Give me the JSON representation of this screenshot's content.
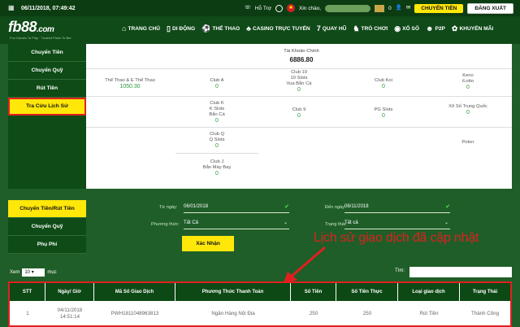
{
  "topbar": {
    "datetime": "06/11/2018, 07:49:42",
    "support_label": "Hỗ Trợ",
    "greeting": "Xin chào,",
    "balance_short": "0",
    "transfer_button": "CHUYỂN TIỀN",
    "logout_button": "ĐĂNG XUẤT"
  },
  "logo": {
    "main": "fb88",
    "suffix": ".com",
    "tagline": "Fun Games To Play · Trusted Place To Bet"
  },
  "nav": [
    "TRANG CHỦ",
    "DI ĐỘNG",
    "THỂ THAO",
    "CASINO TRỰC TUYẾN",
    "QUAY HŨ",
    "TRÒ CHƠI",
    "XỔ SỐ",
    "P2P",
    "KHUYẾN MÃI"
  ],
  "sidebar_top": [
    "Chuyển Tiền",
    "Chuyển Quỹ",
    "Rút Tiền",
    "Tra Cứu Lịch Sử"
  ],
  "main_account": {
    "label": "Tài Khoản Chính",
    "value": "6886.80"
  },
  "wallets": [
    {
      "name": "Thể Thao & E Thể Thao",
      "value": "1050.30"
    },
    {
      "name": "Club A",
      "value": "0"
    },
    {
      "name": "Club 10\n10 Slots\nVua Bắn Cá",
      "value": "0"
    },
    {
      "name": "Club Koi",
      "value": "0"
    },
    {
      "name": "Keno\niLotto",
      "value": "0"
    },
    {
      "name": "Club K\nK Slots\nBắn Cá",
      "value": "0"
    },
    {
      "name": "Club 9",
      "value": "0"
    },
    {
      "name": "PG Slots",
      "value": "0"
    },
    {
      "name": "Xổ Số Trung Quốc",
      "value": "0"
    },
    {
      "name": "Club Q\nQ Slots",
      "value": "0"
    },
    {
      "name": "Poker",
      "value": ""
    },
    {
      "name": "Club J\nBắn Máy Bay",
      "value": "0"
    }
  ],
  "sidebar_bottom": [
    "Chuyển Tiền/Rút Tiền",
    "Chuyển Quỹ",
    "Phụ Phí"
  ],
  "filters": {
    "from_label": "Từ ngày:",
    "from_value": "06/01/2018",
    "to_label": "Đến ngày:",
    "to_value": "06/11/2018",
    "method_label": "Phương thức:",
    "method_value": "Tất Cả",
    "status_label": "Trạng thái:",
    "status_value": "Tất cả",
    "confirm_button": "Xác Nhận"
  },
  "annotation": "Lịch sử giao dịch đã cập nhật",
  "paging": {
    "show_label": "Xem",
    "show_value": "10",
    "unit": "mục",
    "search_label": "Tìm:"
  },
  "table": {
    "headers": [
      "STT",
      "Ngày/ Giờ",
      "Mã Số Giao Dịch",
      "Phương Thức Thanh Toán",
      "Số Tiền",
      "Số Tiền Thực",
      "Loại giao dịch",
      "Trạng Thái"
    ],
    "rows": [
      [
        "1",
        "04/11/2018\n14:51:14",
        "PWH1811048963813",
        "Ngân Hàng Nội Địa",
        "250",
        "250",
        "Rút Tiền",
        "Thành Công"
      ]
    ]
  },
  "colors": {
    "accent": "#ffe70a",
    "dark_green": "#0f4a18",
    "annotation_red": "#e02020",
    "value_green": "#2a9b3c"
  }
}
